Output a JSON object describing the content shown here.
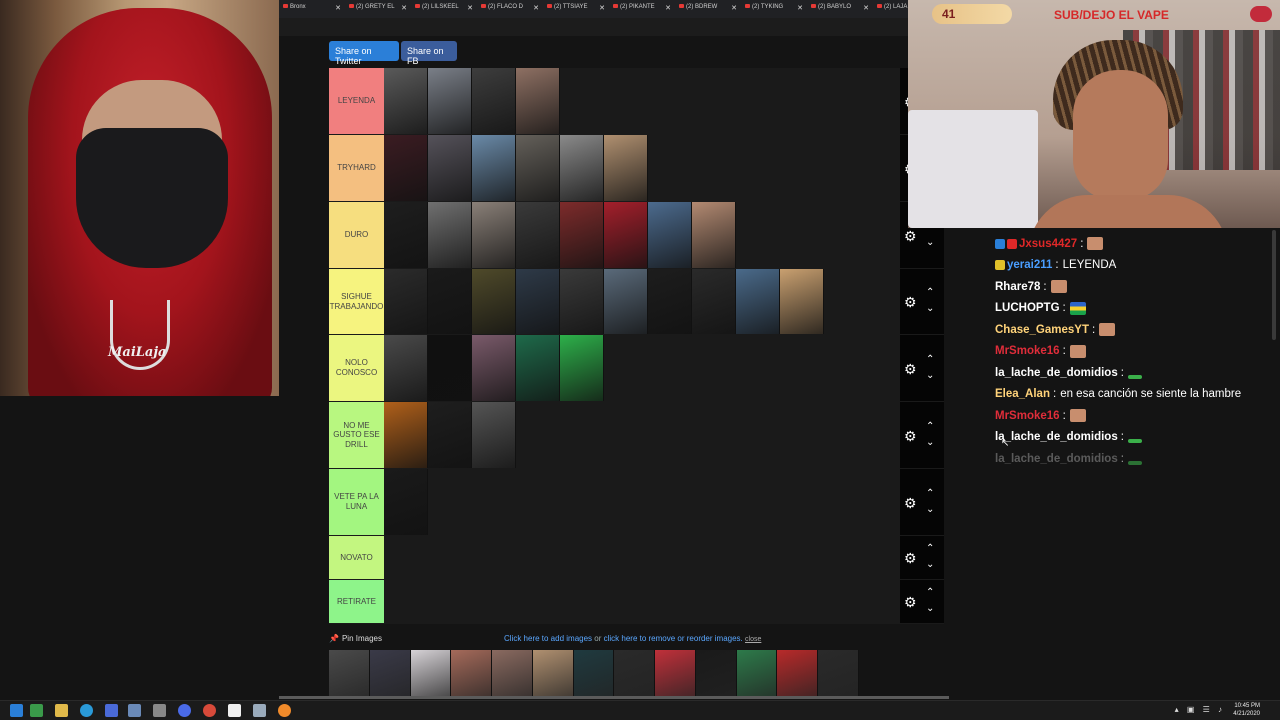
{
  "browser": {
    "tabs": [
      {
        "title": "Bronx"
      },
      {
        "title": "(2) GRETY EL"
      },
      {
        "title": "(2) LILSKEEL"
      },
      {
        "title": "(2) FLACO D"
      },
      {
        "title": "(2) TTSIAYE"
      },
      {
        "title": "(2) PIKANTE"
      },
      {
        "title": "(2) BDREW"
      },
      {
        "title": "(2) TYKING"
      },
      {
        "title": "(2) BABYLO"
      },
      {
        "title": "(2) LAJA - Yo"
      }
    ]
  },
  "share": {
    "twitter": "Share on Twitter",
    "facebook": "Share on FB"
  },
  "tiers": [
    {
      "label": "LEYENDA",
      "color": "#f17f7f",
      "count": 4,
      "colors": [
        "#5a5a5a",
        "#7a7f88",
        "#3d3d3d",
        "#8e7063"
      ]
    },
    {
      "label": "TRYHARD",
      "color": "#f4bf80",
      "count": 6,
      "colors": [
        "#3b1c22",
        "#55525a",
        "#6a8aa8",
        "#64605a",
        "#8a8a8a",
        "#b09070"
      ]
    },
    {
      "label": "DURO",
      "color": "#f6de7f",
      "count": 8,
      "colors": [
        "#1e1e1e",
        "#707070",
        "#8a8078",
        "#3a3a3a",
        "#7d2b2b",
        "#a41f2b",
        "#4c6b8e",
        "#b38a72"
      ]
    },
    {
      "label": "SIGHUE TRABAJANDO",
      "color": "#f6f37f",
      "count": 10,
      "colors": [
        "#2b2b2b",
        "#1a1a1a",
        "#4f4a2a",
        "#2e3a48",
        "#3a3a3a",
        "#5a6a7a",
        "#1d1d1d",
        "#2a2a2a",
        "#4a6a8a",
        "#c9a070"
      ]
    },
    {
      "label": "NOLO CONOSCO",
      "color": "#ebf680",
      "count": 5,
      "colors": [
        "#4a4a4a",
        "#101010",
        "#7a5a6a",
        "#1e6a4a",
        "#2db04a"
      ]
    },
    {
      "label": "NO ME GUSTO ESE DRILL",
      "color": "#b8f780",
      "count": 3,
      "colors": [
        "#b0601a",
        "#1e1e1e",
        "#555555"
      ]
    },
    {
      "label": "VETE PA LA LUNA",
      "color": "#a3f680",
      "count": 1,
      "colors": [
        "#1a1a1a"
      ]
    },
    {
      "label": "NOVATO",
      "color": "#c3f680",
      "count": 0,
      "colors": []
    },
    {
      "label": "RETIRATE",
      "color": "#8ef48a",
      "count": 0,
      "colors": []
    }
  ],
  "footer": {
    "pin_label": "Pin Images",
    "add_text": "Click here to add images",
    "or_text": " or ",
    "reorder_text": "click here to remove or reorder images.",
    "close_text": "close"
  },
  "pool_colors": [
    "#4a4a4a",
    "#3a3a48",
    "#d6d2d6",
    "#a56a5a",
    "#8a6a60",
    "#b09070",
    "#1f3a3f",
    "#2a2a2a",
    "#c0303a",
    "#1a1a1a",
    "#2d7a4a",
    "#b82a2a",
    "#2a2a2a"
  ],
  "overlay": {
    "count": "41",
    "banner": "SUB/DEJO EL VAPE"
  },
  "left_cam": {
    "pendant_text": "MaiLaja"
  },
  "chat": [
    {
      "user": "Jxsus4427",
      "user_color": "#e02828",
      "text": "",
      "emote": "face",
      "badges": [
        "#2a7fd8",
        "#e02828"
      ]
    },
    {
      "user": "yerai211",
      "user_color": "#4a9eff",
      "text": "LEYENDA",
      "emote": "",
      "badges": [
        "#e0c12a"
      ]
    },
    {
      "user": "Rhare78",
      "user_color": "#ffffff",
      "text": "",
      "emote": "face",
      "badges": []
    },
    {
      "user": "LUCHOPTG",
      "user_color": "#ffffff",
      "text": "",
      "emote": "flag",
      "badges": []
    },
    {
      "user": "Chase_GamesYT",
      "user_color": "#ffd37a",
      "text": "",
      "emote": "face",
      "badges": []
    },
    {
      "user": "MrSmoke16",
      "user_color": "#e02d3a",
      "text": "",
      "emote": "face",
      "badges": []
    },
    {
      "user": "la_lache_de_domidios",
      "user_color": "#ffffff",
      "text": "",
      "emote": "green",
      "badges": []
    },
    {
      "user": "Elea_Alan",
      "user_color": "#ffd37a",
      "text": "en esa canción se siente la hambre",
      "emote": "",
      "badges": []
    },
    {
      "user": "MrSmoke16",
      "user_color": "#e02d3a",
      "text": "",
      "emote": "face",
      "badges": []
    },
    {
      "user": "la_lache_de_domidios",
      "user_color": "#ffffff",
      "text": "",
      "emote": "green",
      "badges": []
    },
    {
      "user": "la_lache_de_domidios",
      "user_color": "#8a8a8a",
      "text": "",
      "emote": "green",
      "badges": []
    }
  ],
  "taskbar": {
    "time": "10:45 PM",
    "date": "4/21/2020"
  }
}
